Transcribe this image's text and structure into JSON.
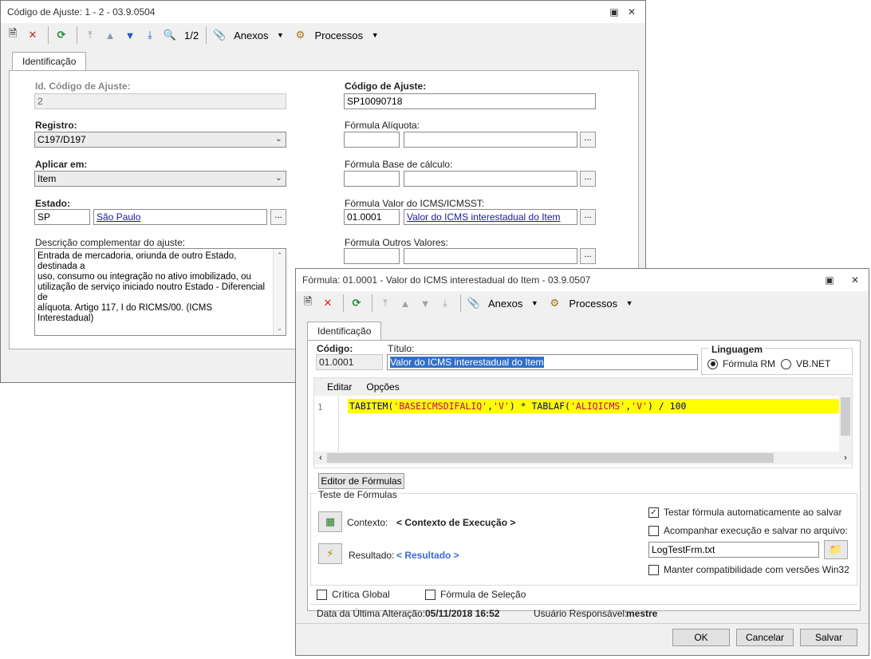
{
  "win1": {
    "title": "Código de Ajuste: 1 - 2 - 03.9.0504",
    "toolbar": {
      "record_nav": "1/2",
      "attachments": "Anexos",
      "processes": "Processos"
    },
    "tab": "Identificação",
    "fields": {
      "id_label": "Id. Código de Ajuste:",
      "id_value": "2",
      "codigo_label": "Código de Ajuste:",
      "codigo_value": "SP10090718",
      "registro_label": "Registro:",
      "registro_value": "C197/D197",
      "formula_aliquota_label": "Fórmula Alíquota:",
      "aplicar_label": "Aplicar em:",
      "aplicar_value": "Item",
      "formula_base_label": "Fórmula Base de cálculo:",
      "estado_label": "Estado:",
      "estado_code": "SP",
      "estado_name": "São Paulo",
      "formula_icms_label": "Fórmula Valor do ICMS/ICMSST:",
      "formula_icms_code": "01.0001",
      "formula_icms_name": "Valor do ICMS interestadual do Item",
      "descricao_label": "Descrição complementar do ajuste:",
      "descricao_lines": [
        "Entrada de mercadoria, oriunda de outro Estado, destinada a",
        "uso, consumo ou integração no ativo imobilizado, ou",
        "utilização de serviço iniciado noutro Estado - Diferencial de",
        "alíquota. Artigo 117, I do RICMS/00. (ICMS Interestadual)"
      ],
      "formula_outros_label": "Fórmula Outros Valores:",
      "dots": "..."
    }
  },
  "win2": {
    "title": "Fórmula: 01.0001 - Valor do ICMS interestadual do Item - 03.9.0507",
    "toolbar": {
      "attachments": "Anexos",
      "processes": "Processos"
    },
    "tab": "Identificação",
    "codigo_label": "Código:",
    "codigo_value": "01.0001",
    "titulo_label": "Título:",
    "titulo_value": "Valor do ICMS interestadual do Item",
    "linguagem_label": "Linguagem",
    "linguagem_options": [
      "Fórmula RM",
      "VB.NET"
    ],
    "linguagem_selected": "Fórmula RM",
    "editor_menu": [
      "Editar",
      "Opções"
    ],
    "code": {
      "line_number": "1",
      "tokens": [
        {
          "text": "TABITEM(",
          "kind": "fn"
        },
        {
          "text": "'BASEICMSDIFALIQ'",
          "kind": "str"
        },
        {
          "text": ",",
          "kind": "fn"
        },
        {
          "text": "'V'",
          "kind": "str"
        },
        {
          "text": ") * TABLAF(",
          "kind": "fn"
        },
        {
          "text": "'ALIQICMS'",
          "kind": "str"
        },
        {
          "text": ",",
          "kind": "fn"
        },
        {
          "text": "'V'",
          "kind": "str"
        },
        {
          "text": ") / 100",
          "kind": "fn"
        }
      ]
    },
    "editor_tab": "Editor de Fórmulas",
    "teste_label": "Teste de Fórmulas",
    "contexto_label": "Contexto:",
    "contexto_value": "< Contexto de Execução >",
    "resultado_label": "Resultado:",
    "resultado_value": "< Resultado >",
    "checks": {
      "testar": {
        "label": "Testar fórmula automaticamente ao salvar",
        "checked": true
      },
      "acompanhar": {
        "label": "Acompanhar execução e salvar no arquivo:",
        "checked": false
      },
      "log_file": "LogTestFrm.txt",
      "manter": {
        "label": "Manter compatibilidade com versões Win32",
        "checked": false
      },
      "critica": {
        "label": "Crítica Global",
        "checked": false
      },
      "selecao": {
        "label": "Fórmula de Seleção",
        "checked": false
      }
    },
    "status": {
      "data_label": "Data da Última Alteração:",
      "data_value": "05/11/2018 16:52",
      "usuario_label": "Usuário Responsável:",
      "usuario_value": "mestre"
    },
    "buttons": {
      "ok": "OK",
      "cancel": "Cancelar",
      "save": "Salvar"
    }
  },
  "colors": {
    "code_highlight": "#ffff00",
    "code_function": "#000080",
    "code_string": "#c0007a",
    "link": "#1a1aa0"
  }
}
